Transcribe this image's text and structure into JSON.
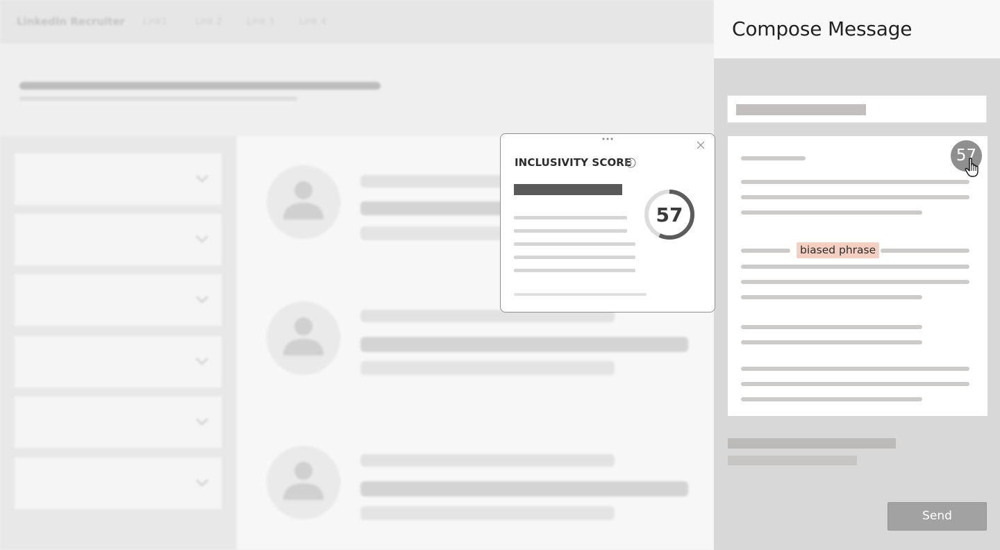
{
  "app": {
    "brand": "LinkedIn Recruiter",
    "nav_links": [
      "Link1",
      "Link 2",
      "Link 3",
      "Link 4"
    ]
  },
  "compose": {
    "title": "Compose Message",
    "highlighted_text": "biased phrase",
    "badge_score": "57",
    "send_label": "Send"
  },
  "popup": {
    "title": "INCLUSIVITY SCORE",
    "score": "57",
    "score_value": 57,
    "score_max": 100
  },
  "colors": {
    "highlight": "#f4cfc2",
    "ring_progress": "#5c5c5c",
    "ring_track": "#dcdcdc"
  },
  "icons": {
    "info": "info-icon",
    "close": "close-icon",
    "drag": "drag-handle-icon",
    "cursor": "hand-pointer-icon",
    "chevron": "chevron-down-icon",
    "avatar": "person-icon"
  }
}
